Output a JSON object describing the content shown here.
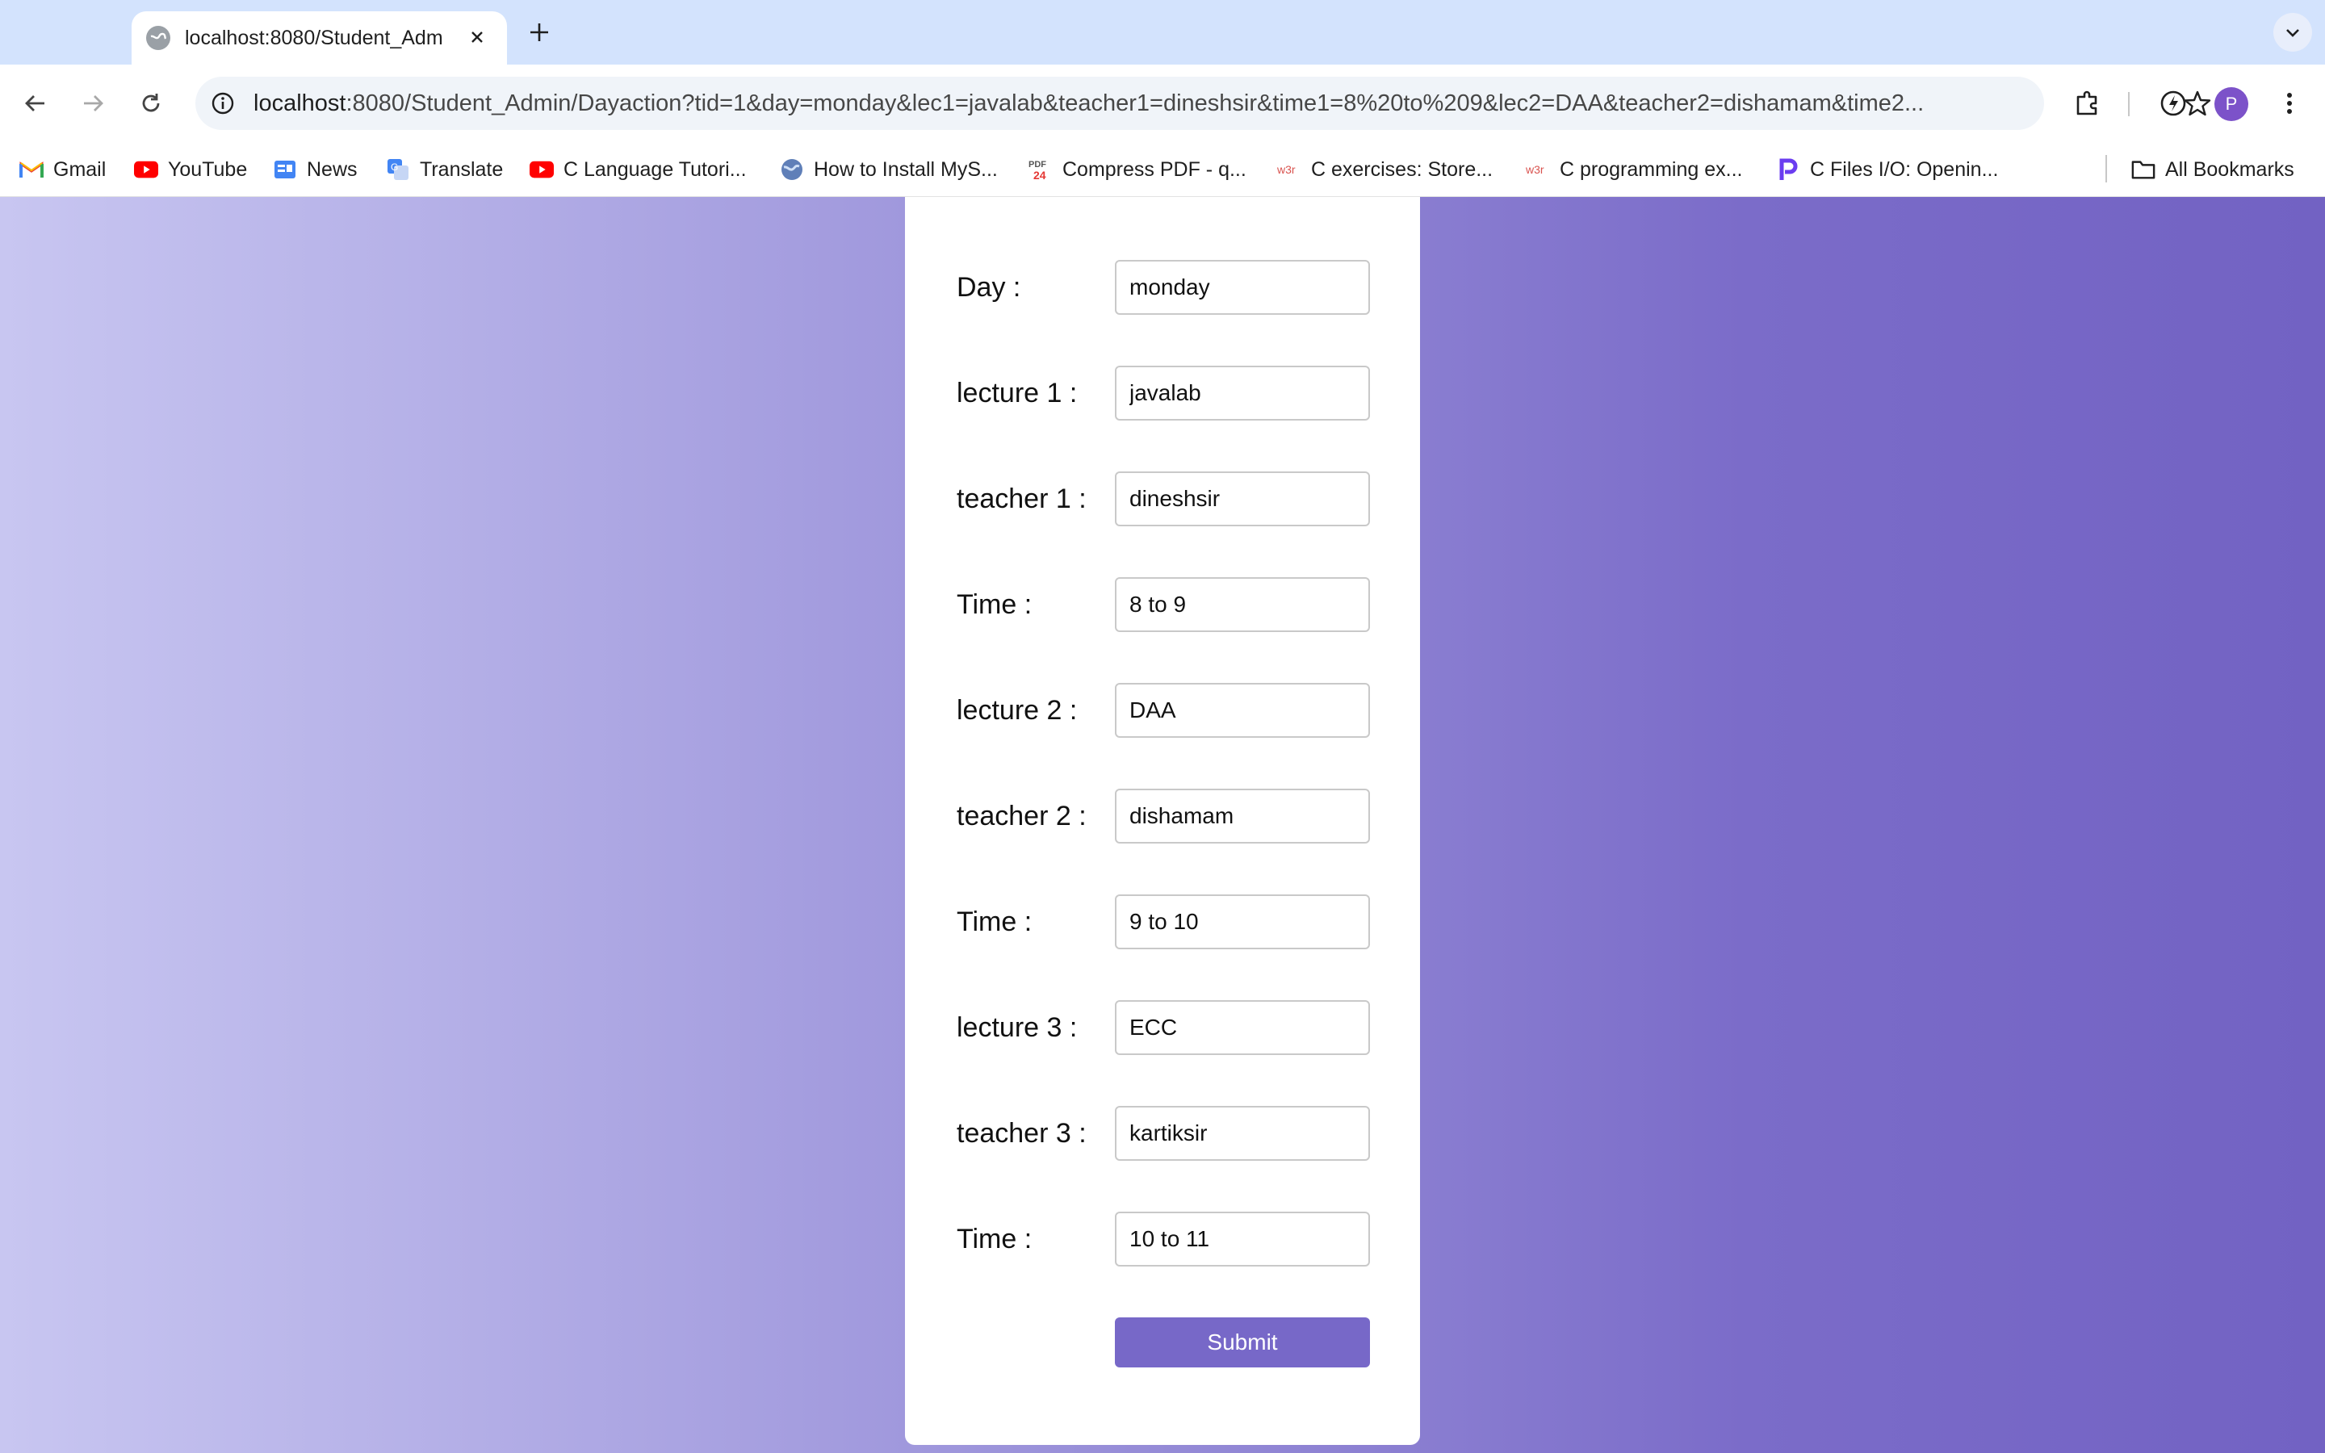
{
  "browser": {
    "tab": {
      "title": "localhost:8080/Student_Adm"
    },
    "address_bar": {
      "host": "localhost",
      "path": ":8080/Student_Admin/Dayaction?tid=1&day=monday&lec1=javalab&teacher1=dineshsir&time1=8%20to%209&lec2=DAA&teacher2=dishamam&time2..."
    },
    "profile_initial": "P",
    "bookmarks": [
      {
        "label": "Gmail",
        "icon": "gmail-icon"
      },
      {
        "label": "YouTube",
        "icon": "youtube-icon"
      },
      {
        "label": "News",
        "icon": "news-icon"
      },
      {
        "label": "Translate",
        "icon": "translate-icon"
      },
      {
        "label": "C Language Tutori...",
        "icon": "youtube-icon"
      },
      {
        "label": "How to Install MyS...",
        "icon": "globe-icon"
      },
      {
        "label": "Compress PDF - q...",
        "icon": "pdf24-icon"
      },
      {
        "label": "C exercises: Store...",
        "icon": "w3r-icon"
      },
      {
        "label": "C programming ex...",
        "icon": "w3r-icon"
      },
      {
        "label": "C Files I/O: Openin...",
        "icon": "programiz-icon"
      }
    ],
    "all_bookmarks_label": "All Bookmarks"
  },
  "form": {
    "fields": [
      {
        "label": "Day :",
        "value": "monday"
      },
      {
        "label": "lecture 1 :",
        "value": "javalab"
      },
      {
        "label": "teacher 1 :",
        "value": "dineshsir"
      },
      {
        "label": "Time :",
        "value": "8 to 9"
      },
      {
        "label": "lecture 2 :",
        "value": "DAA"
      },
      {
        "label": "teacher 2 :",
        "value": "dishamam"
      },
      {
        "label": "Time :",
        "value": "9 to 10"
      },
      {
        "label": "lecture 3 :",
        "value": "ECC"
      },
      {
        "label": "teacher 3 :",
        "value": "kartiksir"
      },
      {
        "label": "Time :",
        "value": "10 to 11"
      }
    ],
    "submit_label": "Submit"
  },
  "colors": {
    "accent": "#7768c8",
    "gradient_start": "#c8c6f1",
    "gradient_end": "#7262c3",
    "chrome_tabbar": "#d3e3fd"
  }
}
